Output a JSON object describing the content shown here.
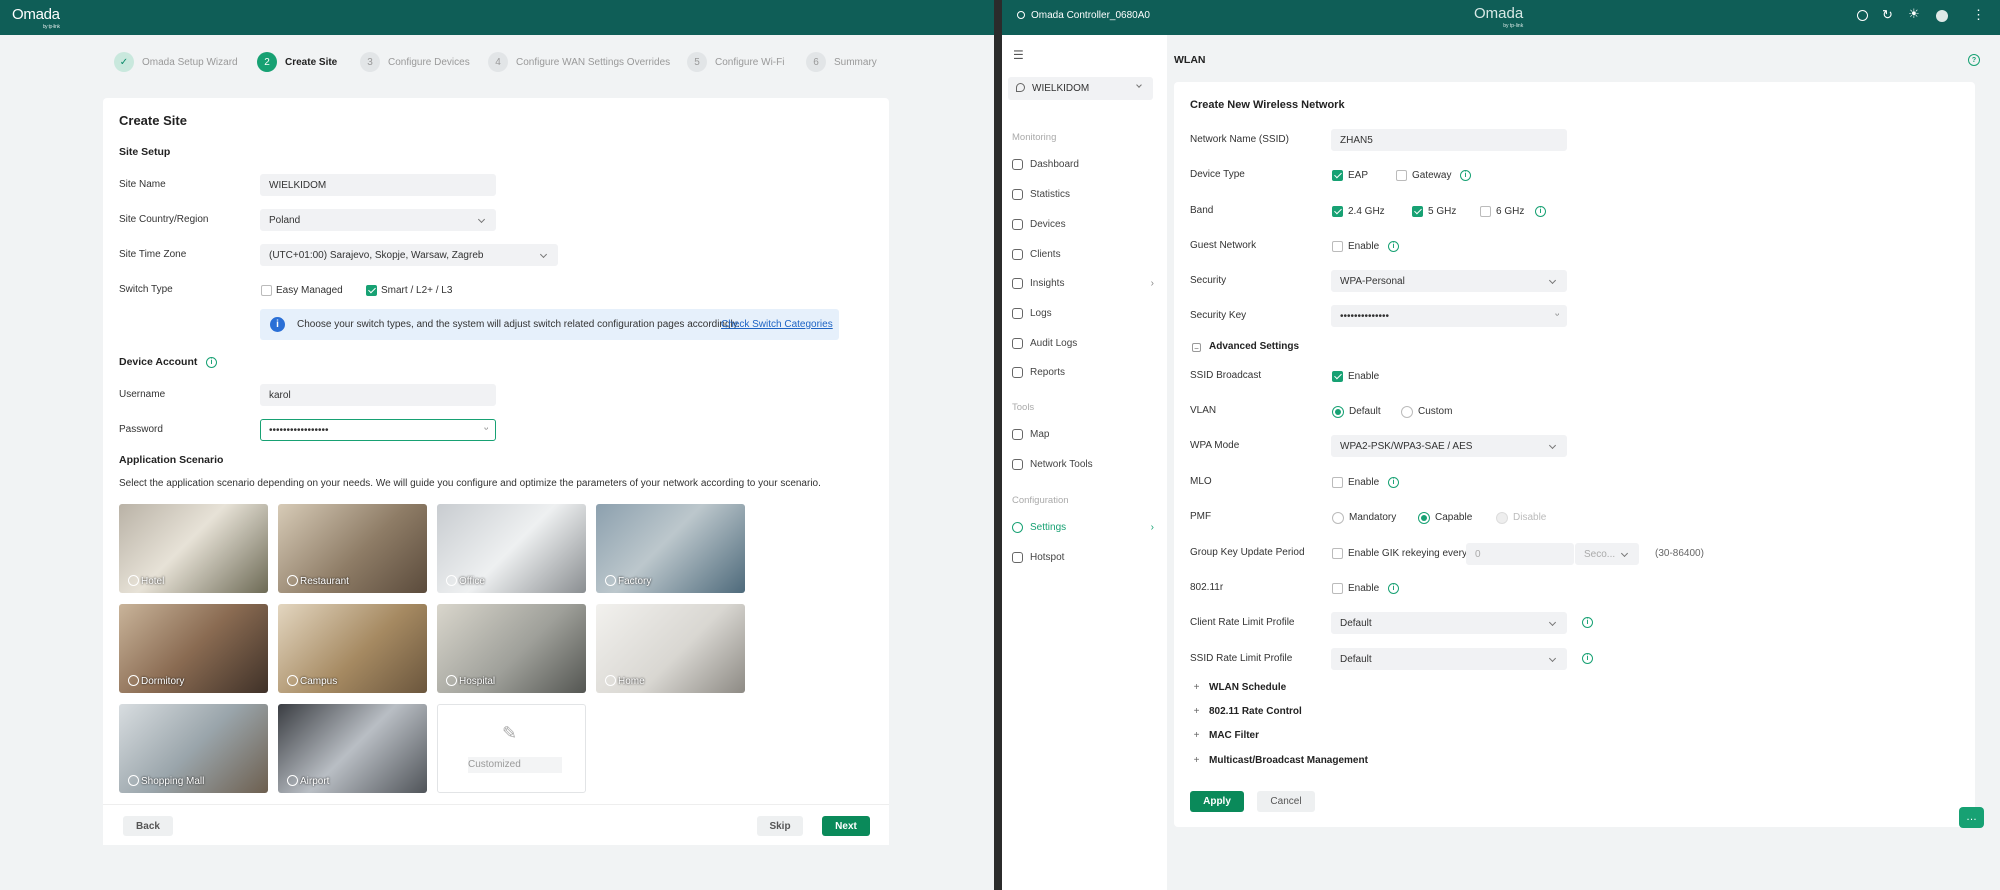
{
  "left": {
    "logo": {
      "name": "Omada",
      "sub": "by tp-link"
    },
    "steps": [
      {
        "num": "",
        "label": "Omada Setup Wizard",
        "state": "done"
      },
      {
        "num": "2",
        "label": "Create Site",
        "state": "active"
      },
      {
        "num": "3",
        "label": "Configure Devices",
        "state": "todo"
      },
      {
        "num": "4",
        "label": "Configure WAN Settings Overrides",
        "state": "todo"
      },
      {
        "num": "5",
        "label": "Configure Wi-Fi",
        "state": "todo"
      },
      {
        "num": "6",
        "label": "Summary",
        "state": "todo"
      }
    ],
    "title": "Create Site",
    "site_setup": "Site Setup",
    "site_name_label": "Site Name",
    "site_name": "WIELKIDOM",
    "country_label": "Site Country/Region",
    "country": "Poland",
    "timezone_label": "Site Time Zone",
    "timezone": "(UTC+01:00) Sarajevo, Skopje, Warsaw, Zagreb",
    "switch_type_label": "Switch Type",
    "switch_easy": "Easy Managed",
    "switch_smart": "Smart / L2+ / L3",
    "switch_note": "Choose your switch types, and the system will adjust switch related configuration pages accordingly.",
    "switch_link": "Check Switch Categories",
    "device_account": "Device Account",
    "username_label": "Username",
    "username": "karol",
    "password_label": "Password",
    "password": "•••••••••••••••••",
    "app_scenario": "Application Scenario",
    "app_desc": "Select the application scenario depending on your needs. We will guide you configure and optimize the parameters of your network according to your scenario.",
    "scenarios": [
      "Hotel",
      "Restaurant",
      "Office",
      "Factory",
      "Dormitory",
      "Campus",
      "Hospital",
      "Home",
      "Shopping Mall",
      "Airport"
    ],
    "customized": "Customized",
    "back": "Back",
    "skip": "Skip",
    "next": "Next"
  },
  "right": {
    "logo": {
      "name": "Omada",
      "sub": "by tp-link"
    },
    "window_title": "Omada Controller_0680A0",
    "site": "WIELKIDOM",
    "sections": {
      "monitoring": "Monitoring",
      "tools": "Tools",
      "configuration": "Configuration"
    },
    "nav_monitoring": [
      "Dashboard",
      "Statistics",
      "Devices",
      "Clients",
      "Insights",
      "Logs",
      "Audit Logs",
      "Reports"
    ],
    "nav_tools": [
      "Map",
      "Network Tools"
    ],
    "nav_config": [
      "Settings",
      "Hotspot"
    ],
    "page_title": "WLAN",
    "form_title": "Create New Wireless Network",
    "ssid_label": "Network Name (SSID)",
    "ssid": "ZHAN5",
    "device_type_label": "Device Type",
    "eap": "EAP",
    "gateway": "Gateway",
    "band_label": "Band",
    "b24": "2.4 GHz",
    "b5": "5 GHz",
    "b6": "6 GHz",
    "guest_label": "Guest Network",
    "enable": "Enable",
    "security_label": "Security",
    "security": "WPA-Personal",
    "key_label": "Security Key",
    "key": "••••••••••••••",
    "advanced": "Advanced Settings",
    "ssid_broadcast_label": "SSID Broadcast",
    "vlan_label": "VLAN",
    "vlan_default": "Default",
    "vlan_custom": "Custom",
    "wpa_mode_label": "WPA Mode",
    "wpa_mode": "WPA2-PSK/WPA3-SAE / AES",
    "mlo_label": "MLO",
    "pmf_label": "PMF",
    "pmf_mandatory": "Mandatory",
    "pmf_capable": "Capable",
    "pmf_disable": "Disable",
    "gk_label": "Group Key Update Period",
    "gk_enable": "Enable GIK rekeying every",
    "gk_value": "0",
    "gk_unit": "Seco...",
    "gk_range": "(30-86400)",
    "r80211_label": "802.11r",
    "client_rate_label": "Client Rate Limit Profile",
    "client_rate": "Default",
    "ssid_rate_label": "SSID Rate Limit Profile",
    "ssid_rate": "Default",
    "expanders": [
      "WLAN Schedule",
      "802.11 Rate Control",
      "MAC Filter",
      "Multicast/Broadcast Management"
    ],
    "apply": "Apply",
    "cancel": "Cancel"
  },
  "colors": {
    "topbar": "#0f5e57",
    "accent": "#17a173",
    "button": "#0a8a5a"
  }
}
